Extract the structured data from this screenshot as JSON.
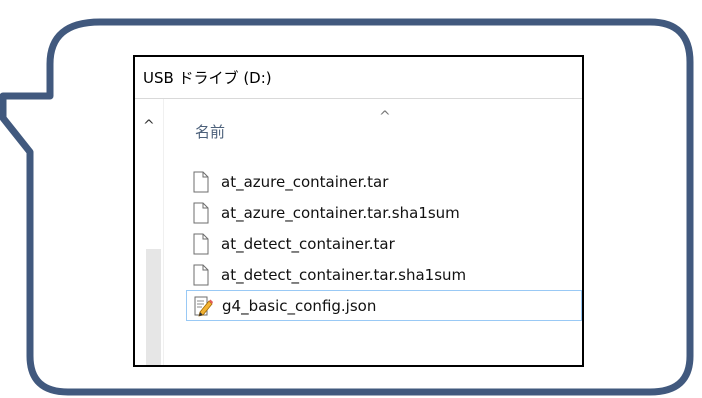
{
  "window": {
    "title": "USB ドライブ (D:)"
  },
  "nav": {
    "scroll_up_glyph": "^"
  },
  "list": {
    "column_name": "名前",
    "sort_glyph": "^",
    "files": [
      {
        "name": "at_azure_container.tar",
        "icon": "document-icon",
        "selected": false
      },
      {
        "name": "at_azure_container.tar.sha1sum",
        "icon": "document-icon",
        "selected": false
      },
      {
        "name": "at_detect_container.tar",
        "icon": "document-icon",
        "selected": false
      },
      {
        "name": "at_detect_container.tar.sha1sum",
        "icon": "document-icon",
        "selected": false
      },
      {
        "name": "g4_basic_config.json",
        "icon": "json-edit-icon",
        "selected": true
      }
    ]
  },
  "colors": {
    "callout_border": "#41597e",
    "selection_border": "#99c9f5"
  }
}
